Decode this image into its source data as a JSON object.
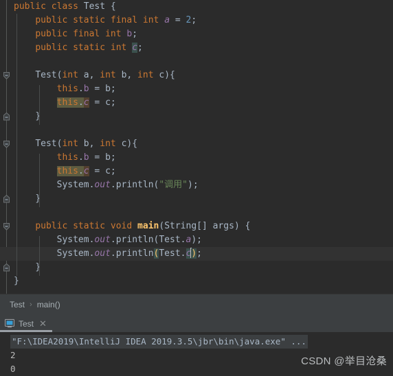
{
  "window": {
    "app": "IntelliJ IDEA",
    "theme_background": "#2b2b2b"
  },
  "editor": {
    "language": "Java",
    "file": "Test.java",
    "lines": [
      "public class Test {",
      "    public static final int a = 2;",
      "    public final int b;",
      "    public static int c;",
      "",
      "    Test(int a, int b, int c){",
      "        this.b = b;",
      "        this.c = c;",
      "    }",
      "",
      "    Test(int b, int c){",
      "        this.b = b;",
      "        this.c = c;",
      "        System.out.println(\"调用\");",
      "    }",
      "",
      "    public static void main(String[] args) {",
      "        System.out.println(Test.a);",
      "        System.out.println(Test.c);",
      "    }",
      "}"
    ],
    "caret_line": 19,
    "caret_text": "Test.c",
    "string_literal": "调用",
    "colors": {
      "keyword": "#cc7832",
      "string": "#6a8759",
      "number": "#6897bb",
      "field": "#9876aa",
      "method": "#ffc66d",
      "text": "#a9b7c6",
      "current_line_bg": "#323232"
    }
  },
  "breadcrumb": {
    "items": [
      "Test",
      "main()"
    ],
    "separator": "›"
  },
  "run_panel": {
    "tab": {
      "label": "Test",
      "icon": "monitor-icon",
      "close_label": "✕"
    },
    "console": {
      "command": "\"F:\\IDEA2019\\IntelliJ IDEA 2019.3.5\\jbr\\bin\\java.exe\" ...",
      "output": [
        "2",
        "0"
      ]
    }
  },
  "watermark": {
    "text": "CSDN @举目沧桑"
  }
}
